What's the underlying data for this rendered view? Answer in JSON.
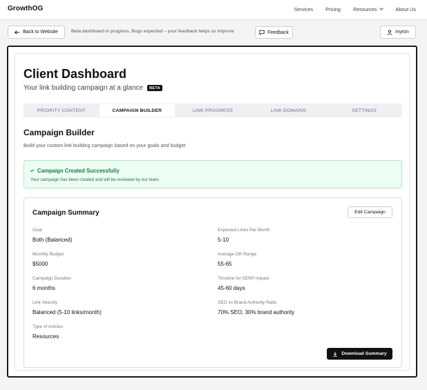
{
  "nav": {
    "brand": "GrowthOG",
    "links": [
      "Services",
      "Pricing",
      "Resources",
      "About Us"
    ]
  },
  "subbar": {
    "back_label": "Back to Website",
    "beta_note": "Beta dashboard in progress. Bugs expected – your feedback helps us improve",
    "feedback_label": "Feedback",
    "user_label": "myron"
  },
  "page": {
    "title": "Client Dashboard",
    "subtitle": "Your link building campaign at a glance",
    "badge": "BETA"
  },
  "tabs": [
    "PRIORITY CONTENT",
    "CAMPAIGN BUILDER",
    "LINK PROGRESS",
    "LINK DOMAINS",
    "SETTINGS"
  ],
  "active_tab": "CAMPAIGN BUILDER",
  "builder": {
    "title": "Campaign Builder",
    "description": "Build your custom link building campaign based on your goals and budget"
  },
  "success": {
    "title": "Campaign Created Successfully",
    "message": "Your campaign has been created and will be reviewed by our team."
  },
  "summary": {
    "title": "Campaign Summary",
    "edit_label": "Edit Campaign",
    "download_label": "Download Summary",
    "left": [
      {
        "label": "Goal",
        "value": "Both (Balanced)"
      },
      {
        "label": "Monthly Budget",
        "value": "$5000"
      },
      {
        "label": "Campaign Duration",
        "value": "6 months"
      },
      {
        "label": "Link Velocity",
        "value": "Balanced (5-10 links/month)"
      },
      {
        "label": "Type of Articles",
        "value": "Resources"
      }
    ],
    "right": [
      {
        "label": "Expected Links Per Month",
        "value": "5-10"
      },
      {
        "label": "Average DR Range",
        "value": "55-65"
      },
      {
        "label": "Timeline for SERP Impact",
        "value": "45-60 days"
      },
      {
        "label": "SEO vs Brand Authority Ratio",
        "value": "70% SEO, 30% brand authority"
      }
    ]
  },
  "colors": {
    "success_bg": "#ecfdf3",
    "success_text": "#1f7a3f",
    "primary_button": "#111111"
  }
}
